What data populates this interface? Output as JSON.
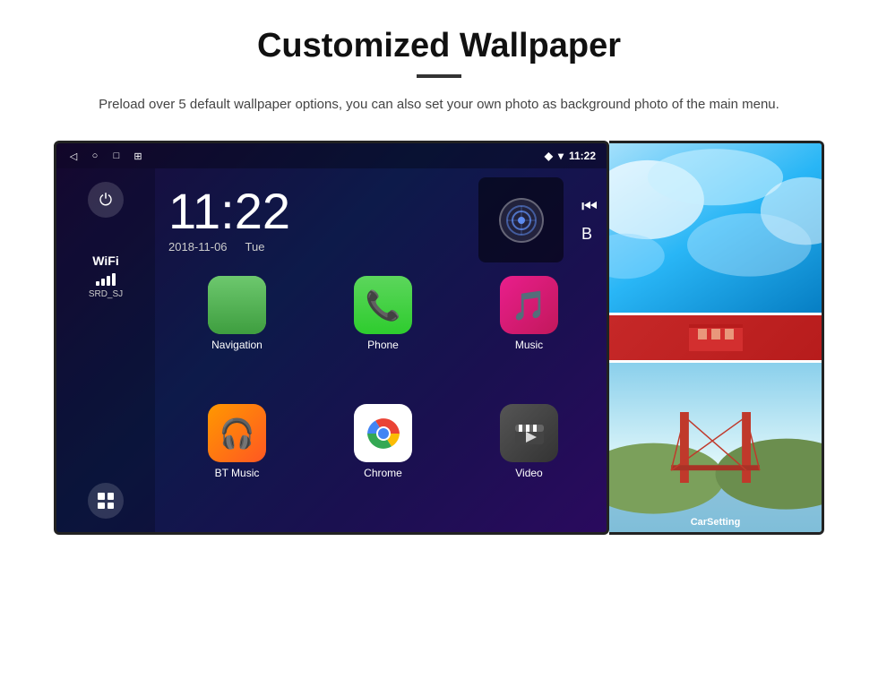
{
  "page": {
    "title": "Customized Wallpaper",
    "description": "Preload over 5 default wallpaper options, you can also set your own photo as background photo of the main menu."
  },
  "device": {
    "time": "11:22",
    "date": "2018-11-06",
    "day": "Tue",
    "wifi_label": "WiFi",
    "wifi_ssid": "SRD_SJ"
  },
  "apps": [
    {
      "id": "navigation",
      "label": "Navigation",
      "type": "nav"
    },
    {
      "id": "phone",
      "label": "Phone",
      "type": "phone"
    },
    {
      "id": "music",
      "label": "Music",
      "type": "music"
    },
    {
      "id": "bt-music",
      "label": "BT Music",
      "type": "bt"
    },
    {
      "id": "chrome",
      "label": "Chrome",
      "type": "chrome"
    },
    {
      "id": "video",
      "label": "Video",
      "type": "video"
    }
  ],
  "wallpapers": [
    {
      "id": "ice",
      "type": "ice"
    },
    {
      "id": "building",
      "type": "building"
    },
    {
      "id": "bridge",
      "type": "bridge"
    }
  ],
  "carsetting_label": "CarSetting",
  "icons": {
    "back": "◁",
    "home": "○",
    "recent": "□",
    "screenshot": "⊞",
    "location": "◆",
    "wifi_signal": "▾",
    "power": "⏻",
    "apps": "⊞"
  }
}
